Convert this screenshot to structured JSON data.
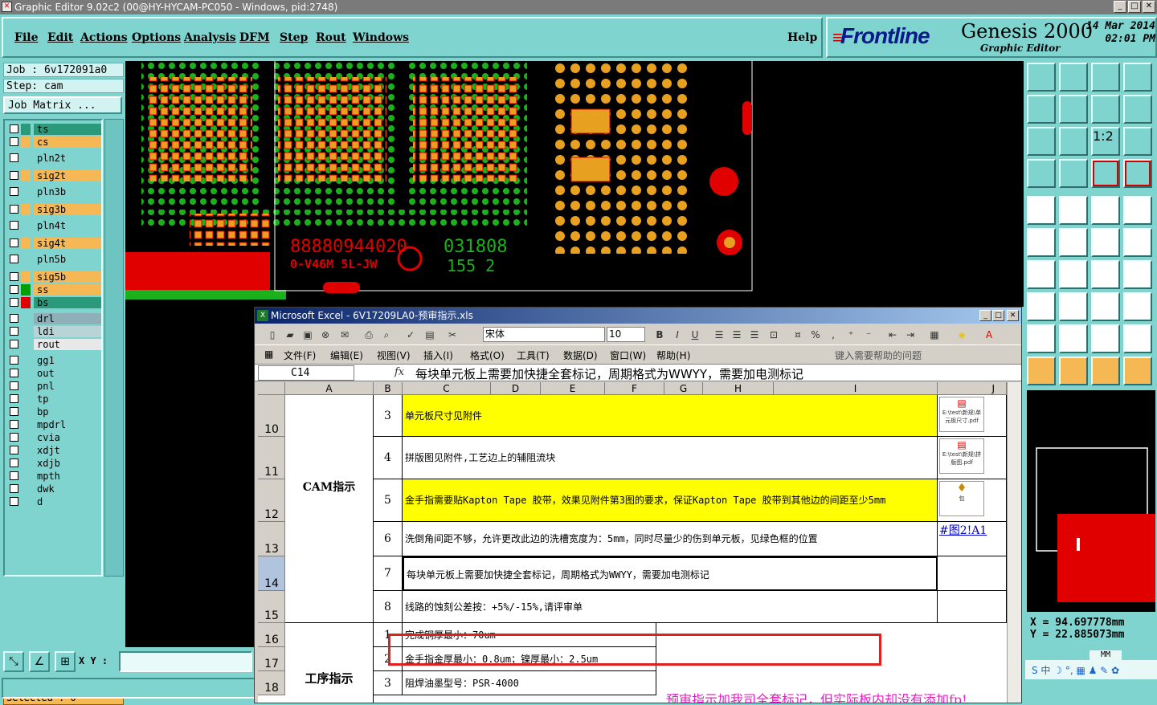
{
  "titlebar": {
    "title": "Graphic Editor 9.02c2 (00@HY-HYCAM-PC050 - Windows, pid:2748)"
  },
  "menus": [
    "File",
    "Edit",
    "Actions",
    "Options",
    "Analysis",
    "DFM",
    "Step",
    "Rout",
    "Windows"
  ],
  "help": "Help",
  "brand": {
    "logo": "Frontline",
    "product": "Genesis 2000",
    "subtitle": "Graphic Editor",
    "date": "14 Mar 2014",
    "time": "02:01 PM"
  },
  "job": {
    "job_label": "Job : 6v172091a0",
    "step_label": "Step: cam",
    "matrix_button": "Job Matrix ..."
  },
  "layers": [
    {
      "name": "ts",
      "color": "#2a9a7a",
      "swatch": "#2a9a7a"
    },
    {
      "name": "cs",
      "color": "#f6b855",
      "swatch": "#f6b855"
    },
    {
      "name": "pln2t",
      "color": "#7fd4d0",
      "swatch": "#7fd4d0"
    },
    {
      "name": "sig2t",
      "color": "#f6b855",
      "swatch": "#f6b855"
    },
    {
      "name": "pln3b",
      "color": "#7fd4d0",
      "swatch": "#7fd4d0"
    },
    {
      "name": "sig3b",
      "color": "#f6b855",
      "swatch": "#f6b855"
    },
    {
      "name": "pln4t",
      "color": "#7fd4d0",
      "swatch": "#7fd4d0"
    },
    {
      "name": "sig4t",
      "color": "#f6b855",
      "swatch": "#f6b855"
    },
    {
      "name": "pln5b",
      "color": "#7fd4d0",
      "swatch": "#7fd4d0"
    },
    {
      "name": "sig5b",
      "color": "#f6b855",
      "swatch": "#f6b855"
    },
    {
      "name": "ss",
      "color": "#f6b855",
      "swatch": "#00a000"
    },
    {
      "name": "bs",
      "color": "#2a9a7a",
      "swatch": "#e00000"
    },
    {
      "name": "drl",
      "color": "#8fb0b8",
      "swatch": "#7fd4d0"
    },
    {
      "name": "ldi",
      "color": "#b8d4d6",
      "swatch": "#7fd4d0"
    },
    {
      "name": "rout",
      "color": "#e8e8e8",
      "swatch": "#7fd4d0"
    },
    {
      "name": "gg1",
      "color": "#7fd4d0",
      "swatch": "#7fd4d0"
    },
    {
      "name": "out",
      "color": "#7fd4d0",
      "swatch": "#7fd4d0"
    },
    {
      "name": "pnl",
      "color": "#7fd4d0",
      "swatch": "#7fd4d0"
    },
    {
      "name": "tp",
      "color": "#7fd4d0",
      "swatch": "#7fd4d0"
    },
    {
      "name": "bp",
      "color": "#7fd4d0",
      "swatch": "#7fd4d0"
    },
    {
      "name": "mpdrl",
      "color": "#7fd4d0",
      "swatch": "#7fd4d0"
    },
    {
      "name": "cvia",
      "color": "#7fd4d0",
      "swatch": "#7fd4d0"
    },
    {
      "name": "xdjt",
      "color": "#7fd4d0",
      "swatch": "#7fd4d0"
    },
    {
      "name": "xdjb",
      "color": "#7fd4d0",
      "swatch": "#7fd4d0"
    },
    {
      "name": "mpth",
      "color": "#7fd4d0",
      "swatch": "#7fd4d0"
    },
    {
      "name": "dwk",
      "color": "#7fd4d0",
      "swatch": "#7fd4d0"
    },
    {
      "name": "d",
      "color": "#7fd4d0",
      "swatch": "#7fd4d0"
    }
  ],
  "selected": "Selected : 0",
  "xy_label": "X Y :",
  "coords": {
    "x": "X  =  94.697778mm",
    "y": "Y  =  22.885073mm"
  },
  "units": "MM",
  "pcb_marks": {
    "text1": "88880944020",
    "text2": "0-V46M 5L-JW",
    "text3": "031808",
    "text4": "155 2"
  },
  "excel": {
    "title": "Microsoft Excel - 6V17209LA0-预审指示.xls",
    "font": "宋体",
    "size": "10",
    "menus": [
      "文件(F)",
      "编辑(E)",
      "视图(V)",
      "插入(I)",
      "格式(O)",
      "工具(T)",
      "数据(D)",
      "窗口(W)",
      "帮助(H)"
    ],
    "help_query": "键入需要帮助的问题",
    "cell_ref": "C14",
    "fx": "fx",
    "formula": "每块单元板上需要加快捷全套标记，周期格式为WWYY，需要加电测标记",
    "columns": [
      "A",
      "B",
      "C",
      "D",
      "E",
      "F",
      "G",
      "H",
      "I",
      "J"
    ],
    "group_cam": "CAM指示",
    "group_process": "工序指示",
    "rows": [
      {
        "rownum": "10",
        "n": "3",
        "text": "单元板尺寸见附件",
        "highlight": "#ffff00"
      },
      {
        "rownum": "11",
        "n": "4",
        "text": "拼版图见附件,工艺边上的辅阻流块",
        "highlight": ""
      },
      {
        "rownum": "12",
        "n": "5",
        "text": "金手指需要贴Kapton Tape 胶带，效果见附件第3图的要求，保证Kapton Tape 胶带到其他边的间距至少5mm",
        "highlight": "#ffff00"
      },
      {
        "rownum": "13",
        "n": "6",
        "text": "洗倒角间距不够，允许更改此边的洗槽宽度为：5mm，同时尽量少的伤到单元板，见绿色框的位置",
        "highlight": ""
      },
      {
        "rownum": "14",
        "n": "7",
        "text": "每块单元板上需要加快捷全套标记，周期格式为WWYY，需要加电测标记",
        "highlight": ""
      },
      {
        "rownum": "15",
        "n": "8",
        "text": "线路的蚀刻公差按：+5%/-15%,请评审单",
        "highlight": ""
      },
      {
        "rownum": "16",
        "n": "1",
        "text": "完成铜厚最小：70um",
        "highlight": ""
      },
      {
        "rownum": "17",
        "n": "2",
        "text": "金手指金厚最小：0.8um；镍厚最小：2.5um",
        "highlight": ""
      },
      {
        "rownum": "18",
        "n": "3",
        "text": "阻焊油墨型号：PSR-4000",
        "highlight": ""
      }
    ],
    "link": "#图2!A1",
    "attach1": "E:\\test\\新规\\单元板尺寸.pdf",
    "attach2": "E:\\test\\新规\\拼版图.pdf",
    "attach3": "包"
  },
  "annotation": "预审指示加我司全套标记，但实际板内却没有添加fp!"
}
